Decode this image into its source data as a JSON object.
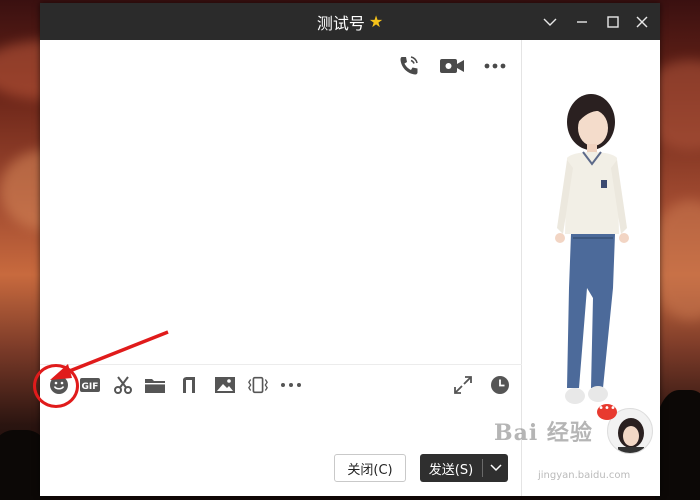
{
  "window": {
    "title": "测试号",
    "title_icon": "star-icon"
  },
  "titlebar_controls": [
    {
      "name": "chevron-down-icon"
    },
    {
      "name": "minimize-icon"
    },
    {
      "name": "maximize-icon"
    },
    {
      "name": "close-icon"
    }
  ],
  "top_actions": [
    "phone-call-icon",
    "video-call-icon",
    "more-icon"
  ],
  "toolbar": [
    "emoji-icon",
    "gif-icon",
    "screenshot-scissors-icon",
    "folder-icon",
    "music-note-icon",
    "image-icon",
    "shake-window-icon",
    "more-icon",
    "expand-icon",
    "history-clock-icon"
  ],
  "buttons": {
    "close_label": "关闭(C)",
    "send_label": "发送(S)"
  },
  "watermark": {
    "text": "Bai 经验",
    "url": "jingyan.baidu.com"
  },
  "colors": {
    "titlebar": "#2b2b2b",
    "send_button": "#2f2f2f",
    "annotation": "#e01b1b",
    "star": "#f5c21a"
  }
}
